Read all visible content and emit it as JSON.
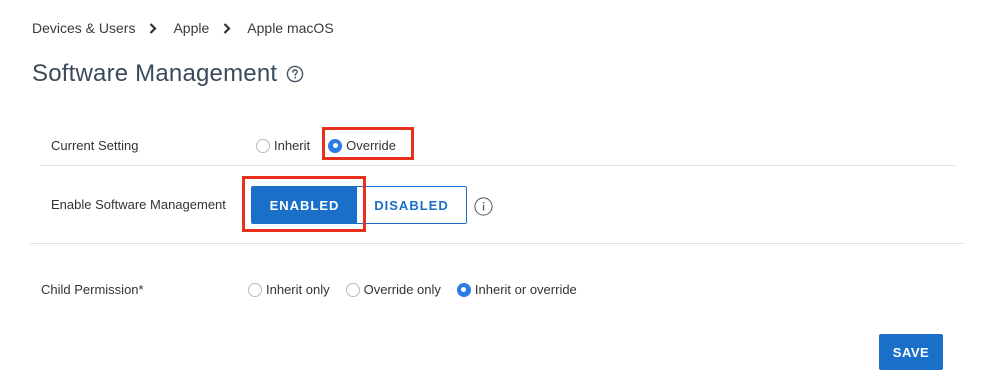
{
  "breadcrumb": {
    "items": [
      "Devices & Users",
      "Apple",
      "Apple macOS"
    ]
  },
  "page": {
    "title": "Software Management",
    "help_icon": "question-circle-icon"
  },
  "current_setting": {
    "label": "Current Setting",
    "options": [
      "Inherit",
      "Override"
    ],
    "selected": "Override"
  },
  "enable_software_management": {
    "label": "Enable Software Management",
    "enabled_label": "ENABLED",
    "disabled_label": "DISABLED",
    "selected": "ENABLED",
    "info_icon": "info-circle-icon"
  },
  "child_permission": {
    "label": "Child Permission*",
    "options": [
      "Inherit only",
      "Override only",
      "Inherit or override"
    ],
    "selected": "Inherit or override"
  },
  "actions": {
    "save_label": "SAVE"
  },
  "colors": {
    "accent": "#1a6fc9",
    "radio_checked": "#2d7be5",
    "highlight": "#e8311c"
  }
}
